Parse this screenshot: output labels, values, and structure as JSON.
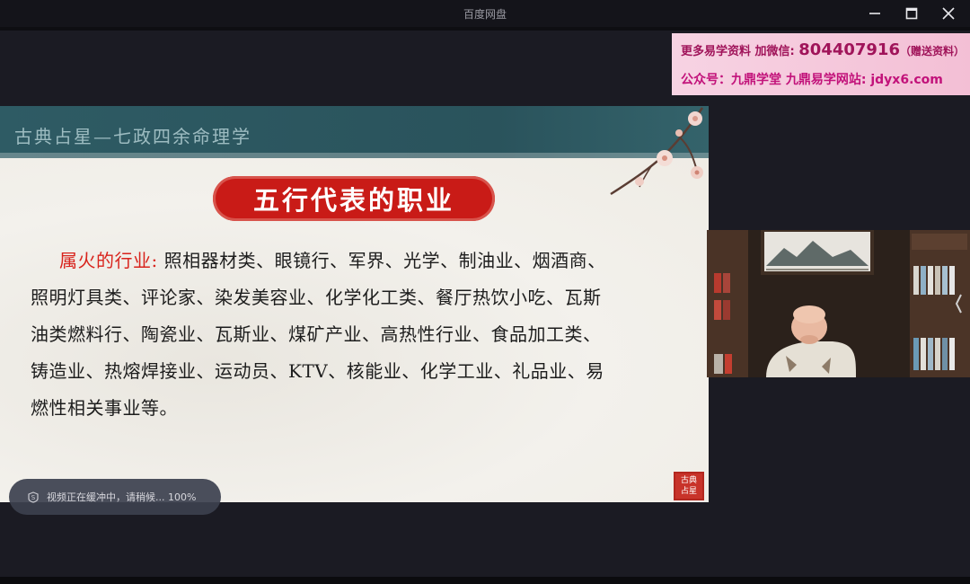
{
  "window": {
    "title": "百度网盘",
    "minimize_icon": "minimize-icon",
    "maximize_icon": "maximize-icon",
    "close_icon": "close-icon"
  },
  "promo": {
    "line1_prefix": "更多易学资料 加微信:",
    "line1_number": "804407916",
    "line1_suffix": "（赠送资料）",
    "line2": "公众号：九鼎学堂 九鼎易学网站: jdyx6.com"
  },
  "slide": {
    "header": "古典占星—七政四余命理学",
    "title": "五行代表的职业",
    "label": "属火的行业:",
    "lines": [
      "照相器材类、眼镜行、军界、光学、制油业、烟酒商、",
      "照明灯具类、评论家、染发美容业、化学化工类、餐厅热饮小吃、瓦斯",
      "油类燃料行、陶瓷业、瓦斯业、煤矿产业、高热性行业、食品加工类、",
      "铸造业、热熔焊接业、运动员、KTV、核能业、化学工业、礼品业、易",
      "燃性相关事业等。"
    ],
    "seal_text": "古典占星"
  },
  "toast": {
    "icon": "buffering-icon",
    "text": "视频正在缓冲中，请稍候... 100%"
  },
  "colors": {
    "accent_red": "#c91b17",
    "header_teal": "#2e5b64",
    "promo_text": "#a0145a"
  }
}
